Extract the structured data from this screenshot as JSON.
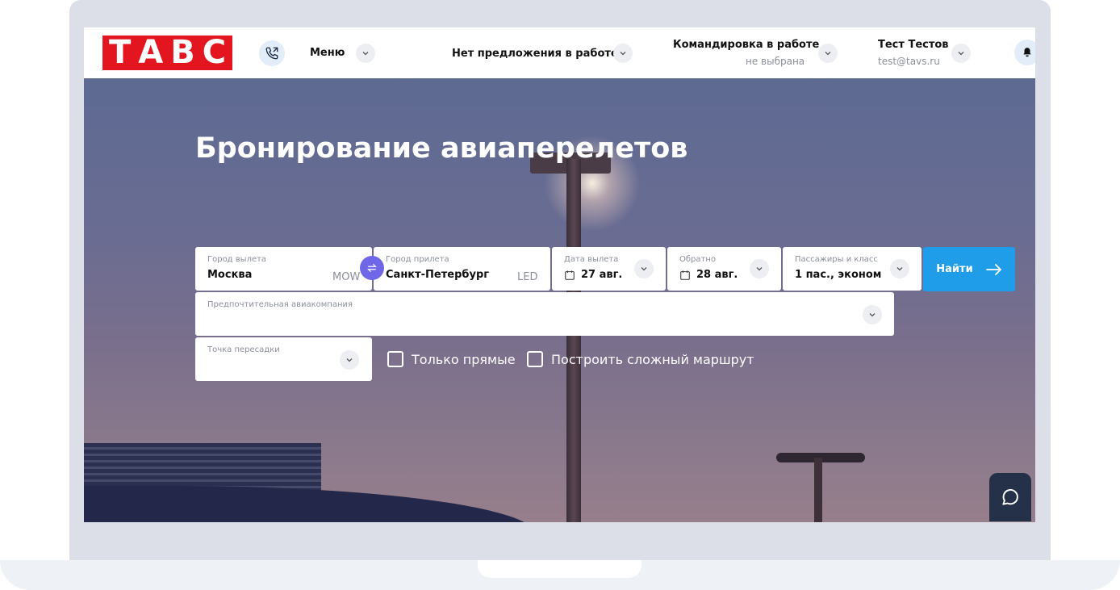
{
  "header": {
    "logo": "ТАВС",
    "menu_label": "Меню",
    "offer_label": "Нет предложения в работе",
    "trip_label": "Командировка в работе",
    "trip_status": "не выбрана",
    "user_name": "Тест Тестов",
    "user_email": "test@tavs.ru"
  },
  "hero": {
    "title": "Бронирование авиаперелетов"
  },
  "form": {
    "from": {
      "label": "Город вылета",
      "value": "Москва",
      "code": "MOW"
    },
    "to": {
      "label": "Город прилета",
      "value": "Санкт-Петербург",
      "code": "LED"
    },
    "depart": {
      "label": "Дата вылета",
      "value": "27 авг."
    },
    "return": {
      "label": "Обратно",
      "value": "28 авг."
    },
    "passengers": {
      "label": "Пассажиры и класс",
      "value": "1 пас., эконом"
    },
    "search_label": "Найти",
    "airline": {
      "label": "Предпочтительная авиакомпания",
      "value": ""
    },
    "transfer": {
      "label": "Точка пересадки",
      "value": ""
    },
    "direct_only": "Только прямые",
    "complex_route": "Построить сложный маршрут"
  },
  "colors": {
    "brand_red": "#e3161f",
    "search_blue": "#1f9de8",
    "swap_purple": "#6f66e8"
  },
  "icons": [
    "phone-icon",
    "chevron-down-icon",
    "bell-icon",
    "swap-icon",
    "calendar-icon",
    "arrow-right-icon",
    "chat-icon"
  ]
}
